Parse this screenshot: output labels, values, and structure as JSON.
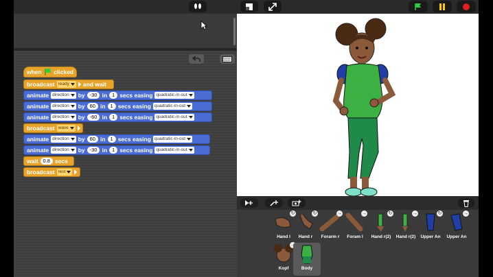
{
  "toolbar": {
    "icons": [
      "footprints-icon",
      "stage-size-icon",
      "fullscreen-icon",
      "green-flag-icon",
      "pause-icon",
      "stop-icon"
    ]
  },
  "script": {
    "hat": {
      "when": "when",
      "clicked": "clicked"
    },
    "b1": {
      "label": "broadcast",
      "msg": "ready",
      "suffix": "and wait"
    },
    "b2": {
      "label": "animate",
      "prop": "direction",
      "by": "by",
      "val": "-30",
      "in": "in",
      "secs_val": "1",
      "secs": "secs easing",
      "easing": "quadratic-in-out"
    },
    "b3": {
      "label": "animate",
      "prop": "direction",
      "by": "by",
      "val": "60",
      "in": "in",
      "secs_val": "1",
      "secs": "secs easing",
      "easing": "quadratic-in-out"
    },
    "b4": {
      "label": "animate",
      "prop": "direction",
      "by": "by",
      "val": "-60",
      "in": "in",
      "secs_val": "1",
      "secs": "secs easing",
      "easing": "quadratic-in-out"
    },
    "b5": {
      "label": "broadcast",
      "msg": "wave"
    },
    "b6": {
      "label": "animate",
      "prop": "direction",
      "by": "by",
      "val": "60",
      "in": "in",
      "secs_val": "1",
      "secs": "secs easing",
      "easing": "quadratic-in-out"
    },
    "b7": {
      "label": "animate",
      "prop": "direction",
      "by": "by",
      "val": "-30",
      "in": "in",
      "secs_val": "1",
      "secs": "secs easing",
      "easing": "quadratic-in-out"
    },
    "b8": {
      "label": "wait",
      "val": "0.8",
      "suffix": "secs"
    },
    "b9": {
      "label": "broadcast",
      "msg": "rest"
    }
  },
  "sprites": [
    {
      "name": "Hand l"
    },
    {
      "name": "Hand r"
    },
    {
      "name": "Forarm r"
    },
    {
      "name": "Foram l"
    },
    {
      "name": "Hand r(2)"
    },
    {
      "name": "Hand r(2)"
    },
    {
      "name": "Upper An"
    },
    {
      "name": "Upper An"
    },
    {
      "name": "Kopf"
    },
    {
      "name": "Body"
    }
  ],
  "colors": {
    "event": "#e8a42a",
    "motion": "#4a6cd4",
    "stage": "#ffffff",
    "shirt": "#3cb043",
    "sleeve": "#1f3fa6",
    "pants": "#1f8a4a"
  }
}
